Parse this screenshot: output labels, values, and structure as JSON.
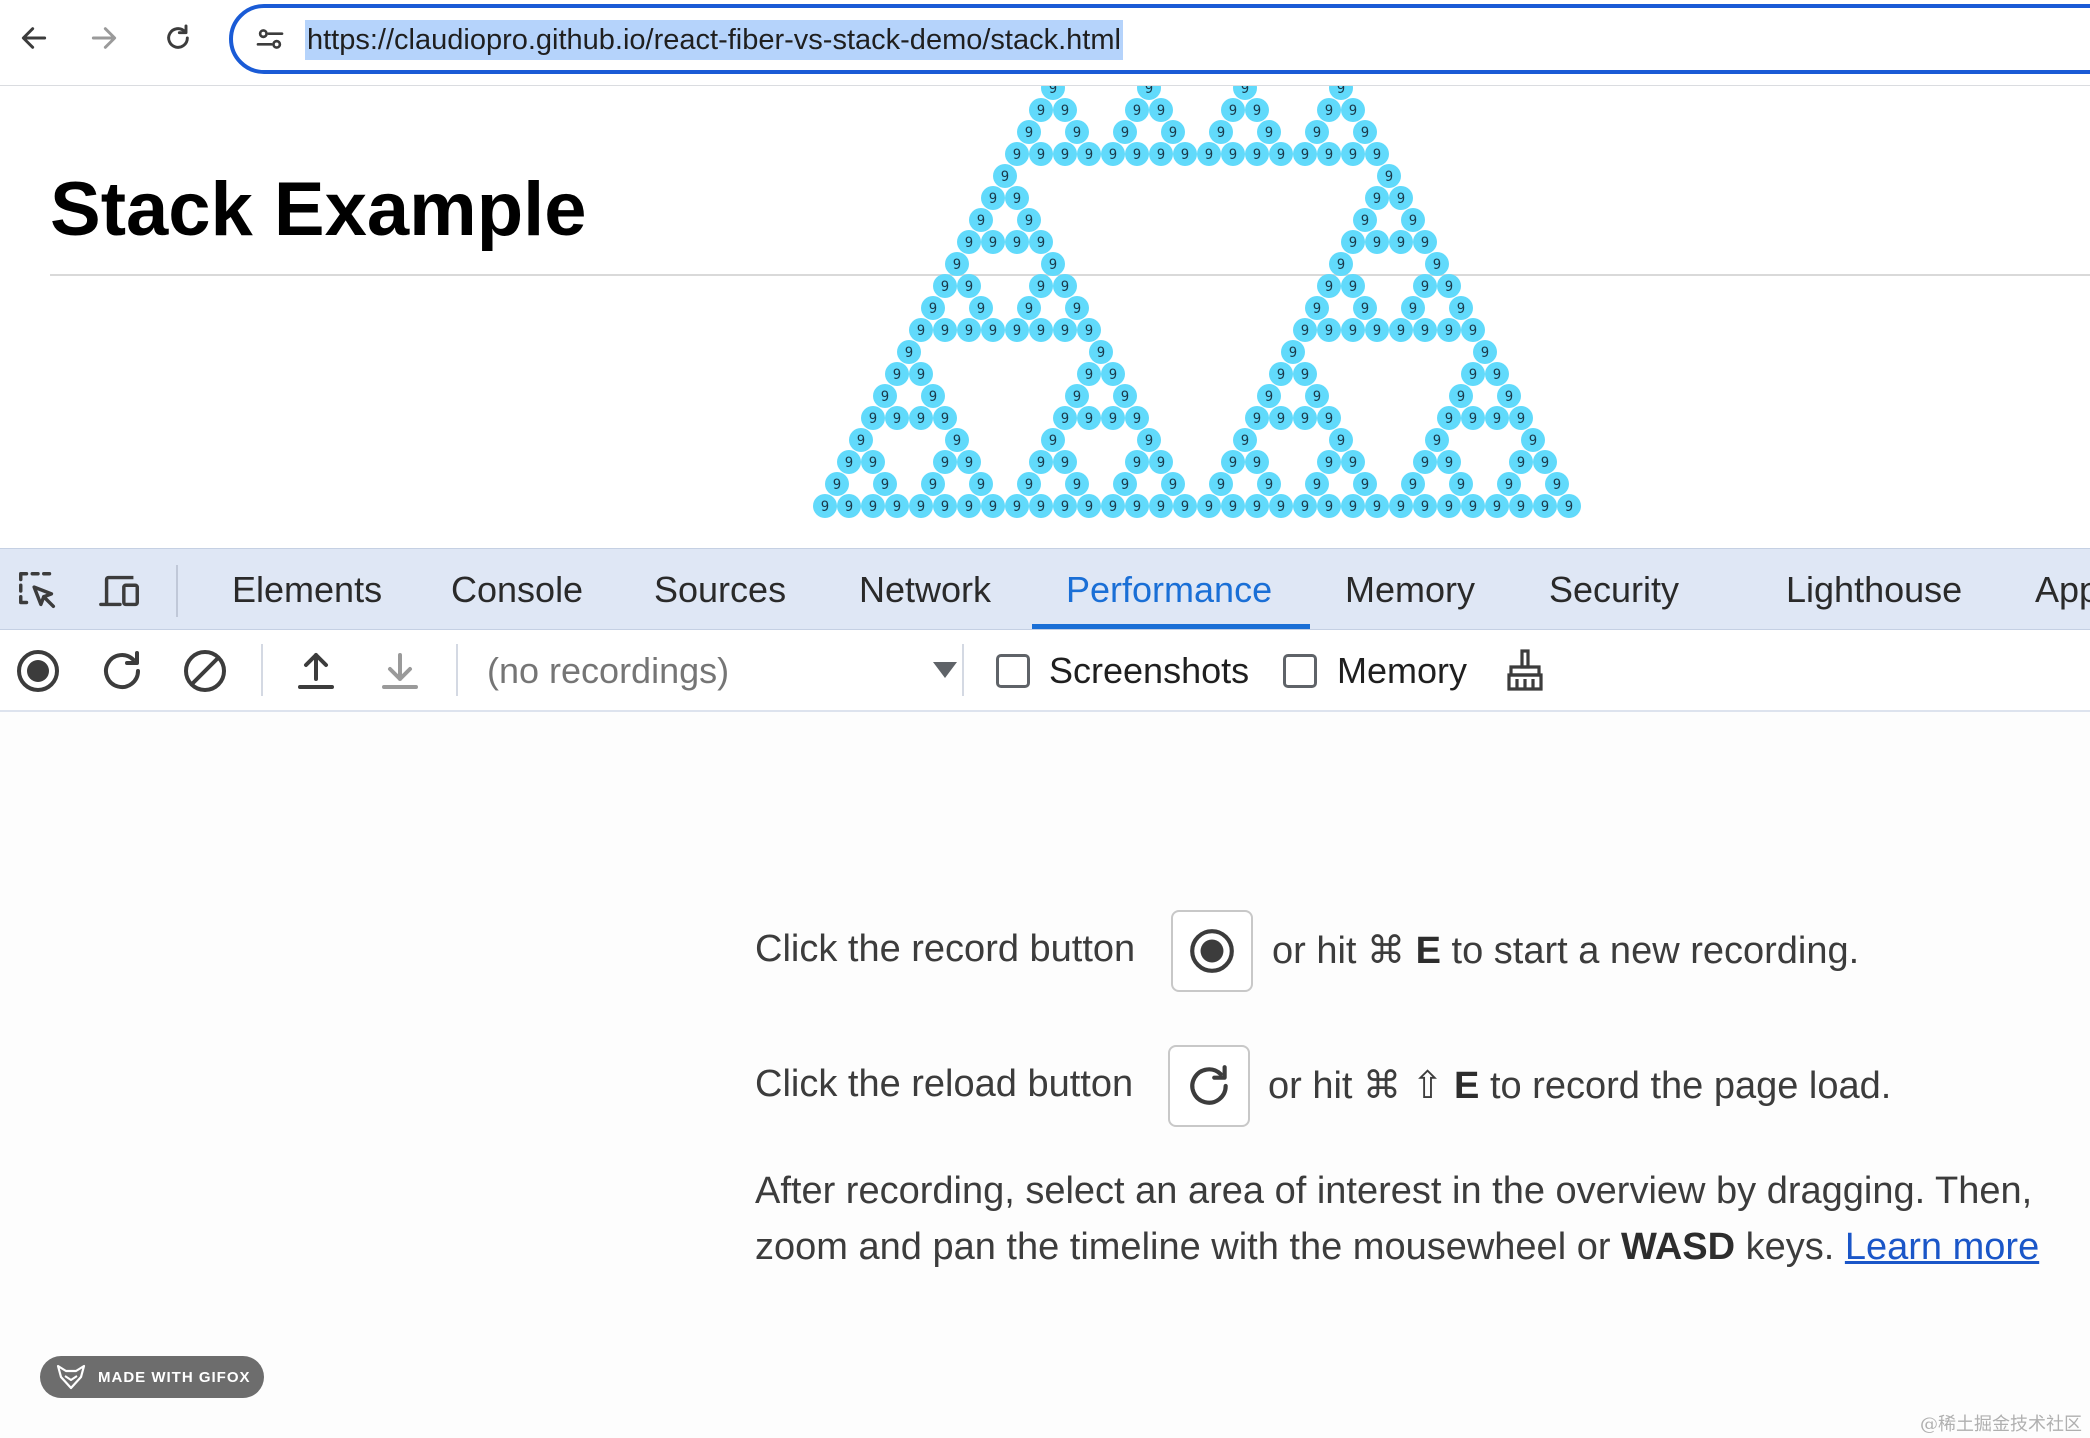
{
  "browser": {
    "url": "https://claudiopro.github.io/react-fiber-vs-stack-demo/stack.html",
    "accent_color": "#1a5bd6"
  },
  "page": {
    "heading": "Stack Example",
    "dot_label": "9",
    "dot_color": "#61dafb"
  },
  "devtools": {
    "tabs": [
      "Elements",
      "Console",
      "Sources",
      "Network",
      "Performance",
      "Memory",
      "Security",
      "Lighthouse",
      "App"
    ],
    "active_tab": "Performance",
    "toolbar": {
      "recordings_placeholder": "(no recordings)",
      "screenshots_label": "Screenshots",
      "memory_label": "Memory"
    },
    "landing": {
      "record_line_prefix": "Click the record button",
      "record_line_middle": "or hit ⌘",
      "record_key": "E",
      "record_line_suffix": "to start a new recording.",
      "reload_line_prefix": "Click the reload button",
      "reload_line_middle": "or hit ⌘",
      "reload_shift": "⇧",
      "reload_key": "E",
      "reload_line_suffix": "to record the page load.",
      "after_line_1": "After recording, select an area of interest in the overview by dragging. Then,",
      "after_line_2_prefix": "zoom and pan the timeline with the mousewheel or",
      "after_line_2_keys": "WASD",
      "after_line_2_suffix": "keys.",
      "learn_more": "Learn more"
    }
  },
  "overlay": {
    "gifox_label": "MADE WITH GIFOX",
    "watermark": "@稀土掘金技术社区"
  }
}
